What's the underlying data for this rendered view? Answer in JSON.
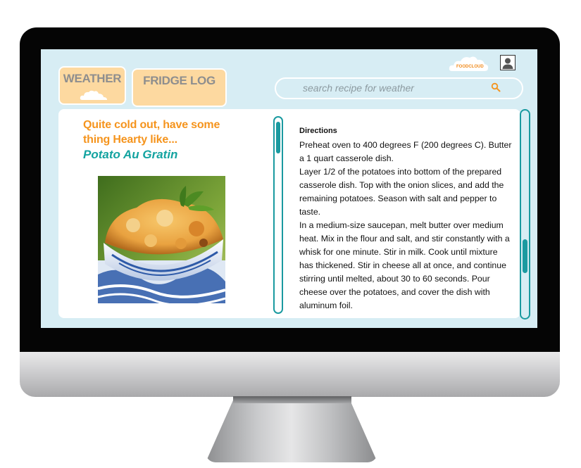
{
  "nav": {
    "weather_label": "WEATHER",
    "fridge_log_label": "FRIDGE LOG"
  },
  "search": {
    "placeholder": "search recipe for weather"
  },
  "logo": {
    "text": "FOODCLOUD"
  },
  "recipe": {
    "headline": "Quite cold out, have some thing Hearty like...",
    "name": "Potato Au Gratin",
    "photo_alt": "Potato Au Gratin"
  },
  "directions": {
    "title": "Directions",
    "text": "Preheat oven to 400 degrees F (200 degrees C). Butter a 1 quart casserole dish.\nLayer 1/2 of the potatoes into bottom of the prepared casserole dish. Top with the onion slices, and add the remaining potatoes. Season with salt and pepper to taste.\nIn a medium-size saucepan, melt butter over medium heat. Mix in the flour and salt, and stir constantly with a whisk for one minute. Stir in milk. Cook until mixture has thickened. Stir in cheese all at once, and continue stirring until melted, about 30 to 60 seconds. Pour cheese over the potatoes, and cover the dish with aluminum foil."
  },
  "colors": {
    "screen_bg": "#d7edf4",
    "button_bg": "#fdd9a0",
    "headline": "#f5941d",
    "recipe_name": "#13a3a0",
    "scrollbar": "#1a9aa0"
  },
  "icons": [
    "cloud-icon",
    "search-icon",
    "user-avatar-icon",
    "foodcloud-logo"
  ]
}
